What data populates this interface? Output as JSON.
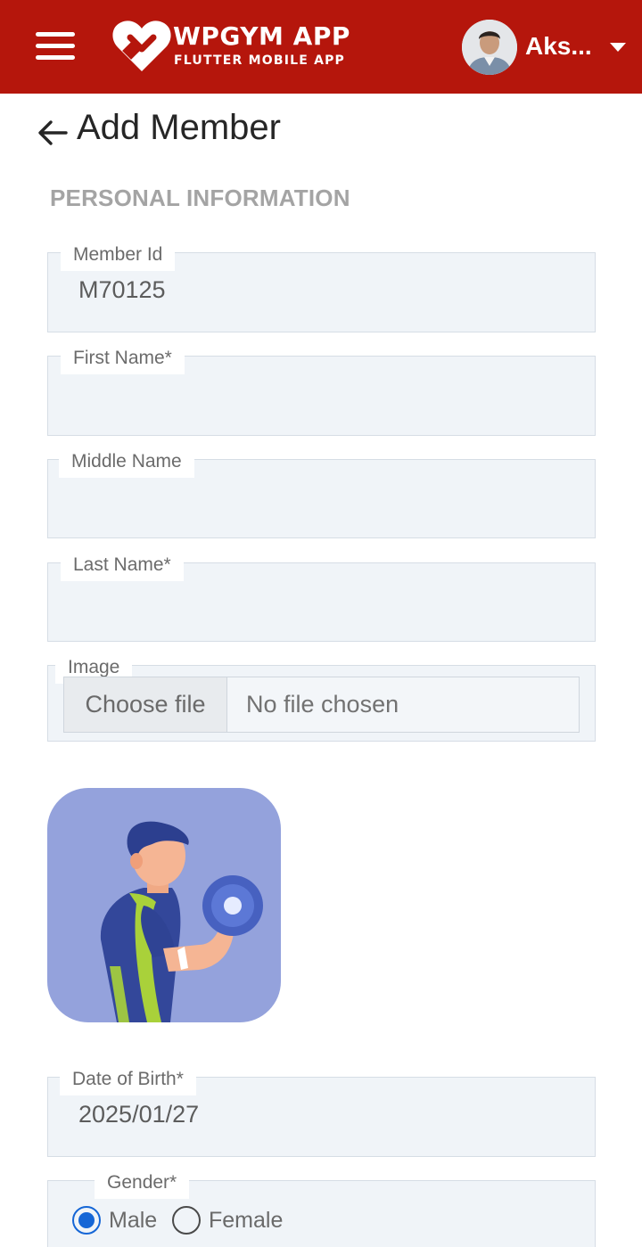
{
  "header": {
    "brand_title": "WPGYM APP",
    "brand_subtitle": "FLUTTER MOBILE APP",
    "user_name": "Aks...",
    "background_color": "#b5160c"
  },
  "page": {
    "title": "Add Member",
    "section_title": "PERSONAL INFORMATION"
  },
  "form": {
    "member_id": {
      "label": "Member Id",
      "value": "M70125"
    },
    "first_name": {
      "label": "First Name*",
      "value": ""
    },
    "middle_name": {
      "label": "Middle Name",
      "value": ""
    },
    "last_name": {
      "label": "Last Name*",
      "value": ""
    },
    "image": {
      "label": "Image",
      "button_label": "Choose file",
      "status": "No file chosen"
    },
    "dob": {
      "label": "Date of Birth*",
      "value": "2025/01/27"
    },
    "gender": {
      "label": "Gender*",
      "options": [
        "Male",
        "Female"
      ],
      "selected": "Male"
    }
  },
  "icons": {
    "menu": "hamburger-menu-icon",
    "back": "arrow-left-icon",
    "dropdown": "caret-down-icon",
    "logo": "heart-logo-icon"
  }
}
